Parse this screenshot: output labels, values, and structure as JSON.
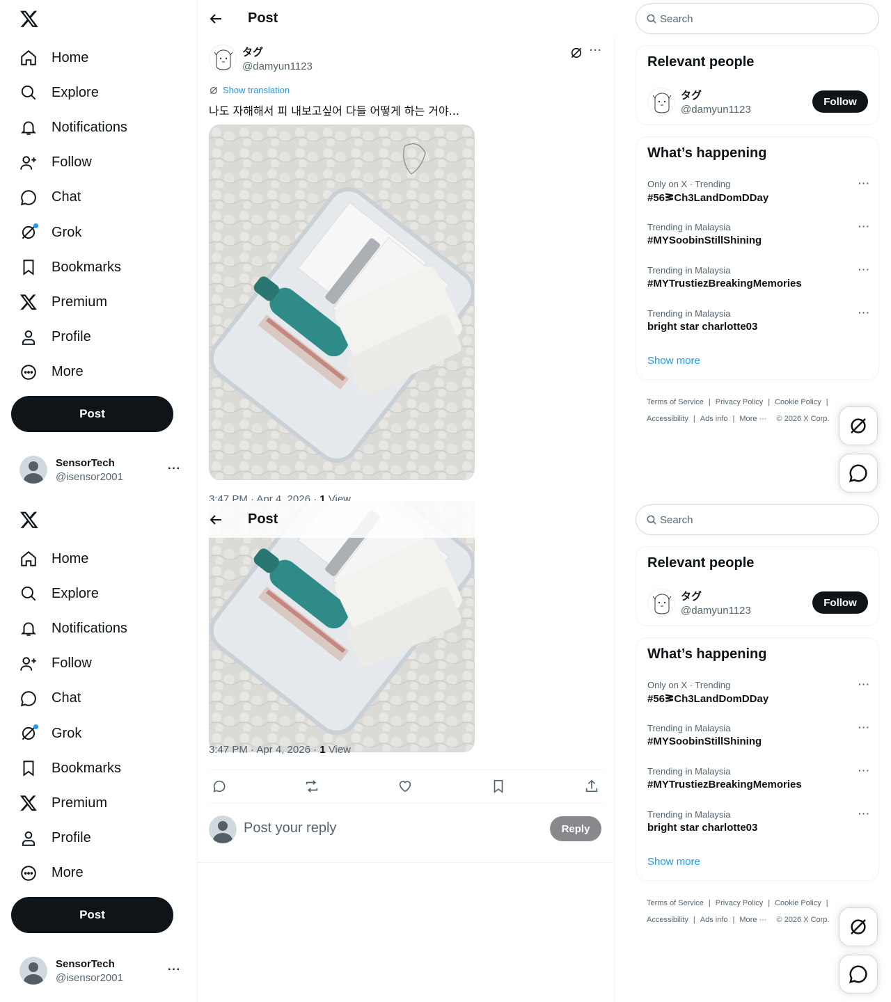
{
  "nav": {
    "items": [
      {
        "label": "Home",
        "icon": "home-icon"
      },
      {
        "label": "Explore",
        "icon": "search-icon"
      },
      {
        "label": "Notifications",
        "icon": "bell-icon"
      },
      {
        "label": "Follow",
        "icon": "add-person-icon"
      },
      {
        "label": "Chat",
        "icon": "chat-bubble-icon"
      },
      {
        "label": "Grok",
        "icon": "grok-icon"
      },
      {
        "label": "Bookmarks",
        "icon": "bookmark-icon"
      },
      {
        "label": "Premium",
        "icon": "x-logo-icon"
      },
      {
        "label": "Profile",
        "icon": "person-icon"
      },
      {
        "label": "More",
        "icon": "more-circle-icon"
      }
    ],
    "post_button": "Post",
    "account": {
      "name": "SensorTech",
      "handle": "@isensor2001",
      "more": "···"
    }
  },
  "header": {
    "title": "Post"
  },
  "post": {
    "author_name": "タグ",
    "author_handle": "@damyun1123",
    "show_translation": "Show translation",
    "text": "나도 자해해서 피 내보고싶어 다들 어떻게 하는 거야...",
    "meta_time": "3:47 PM · Apr 4, 2026 · ",
    "meta_views_count": "1",
    "meta_views_label": " View",
    "more": "···"
  },
  "reply": {
    "placeholder": "Post your reply",
    "button": "Reply"
  },
  "sidebar": {
    "search_placeholder": "Search",
    "relevant": {
      "title": "Relevant people",
      "name": "タグ",
      "handle": "@damyun1123",
      "follow": "Follow"
    },
    "happening": {
      "title": "What’s happening",
      "trends": [
        {
          "context": "Only on X · Trending",
          "name": "#56ᕒCh3LandDomDDay"
        },
        {
          "context": "Trending in Malaysia",
          "name": "#MYSoobinStillShining"
        },
        {
          "context": "Trending in Malaysia",
          "name": "#MYTrustiezBreakingMemories"
        },
        {
          "context": "Trending in Malaysia",
          "name": "bright star charlotte03"
        }
      ],
      "show_more": "Show more",
      "trend_more": "···"
    },
    "footer": {
      "terms": "Terms of Service",
      "privacy": "Privacy Policy",
      "cookie": "Cookie Policy",
      "accessibility": "Accessibility",
      "ads": "Ads info",
      "more": "More ···",
      "copyright": "© 2026 X Corp."
    }
  },
  "colors": {
    "accent": "#1d9bf0",
    "text": "#0f1419",
    "muted": "#536471",
    "border": "#eff3f4"
  }
}
